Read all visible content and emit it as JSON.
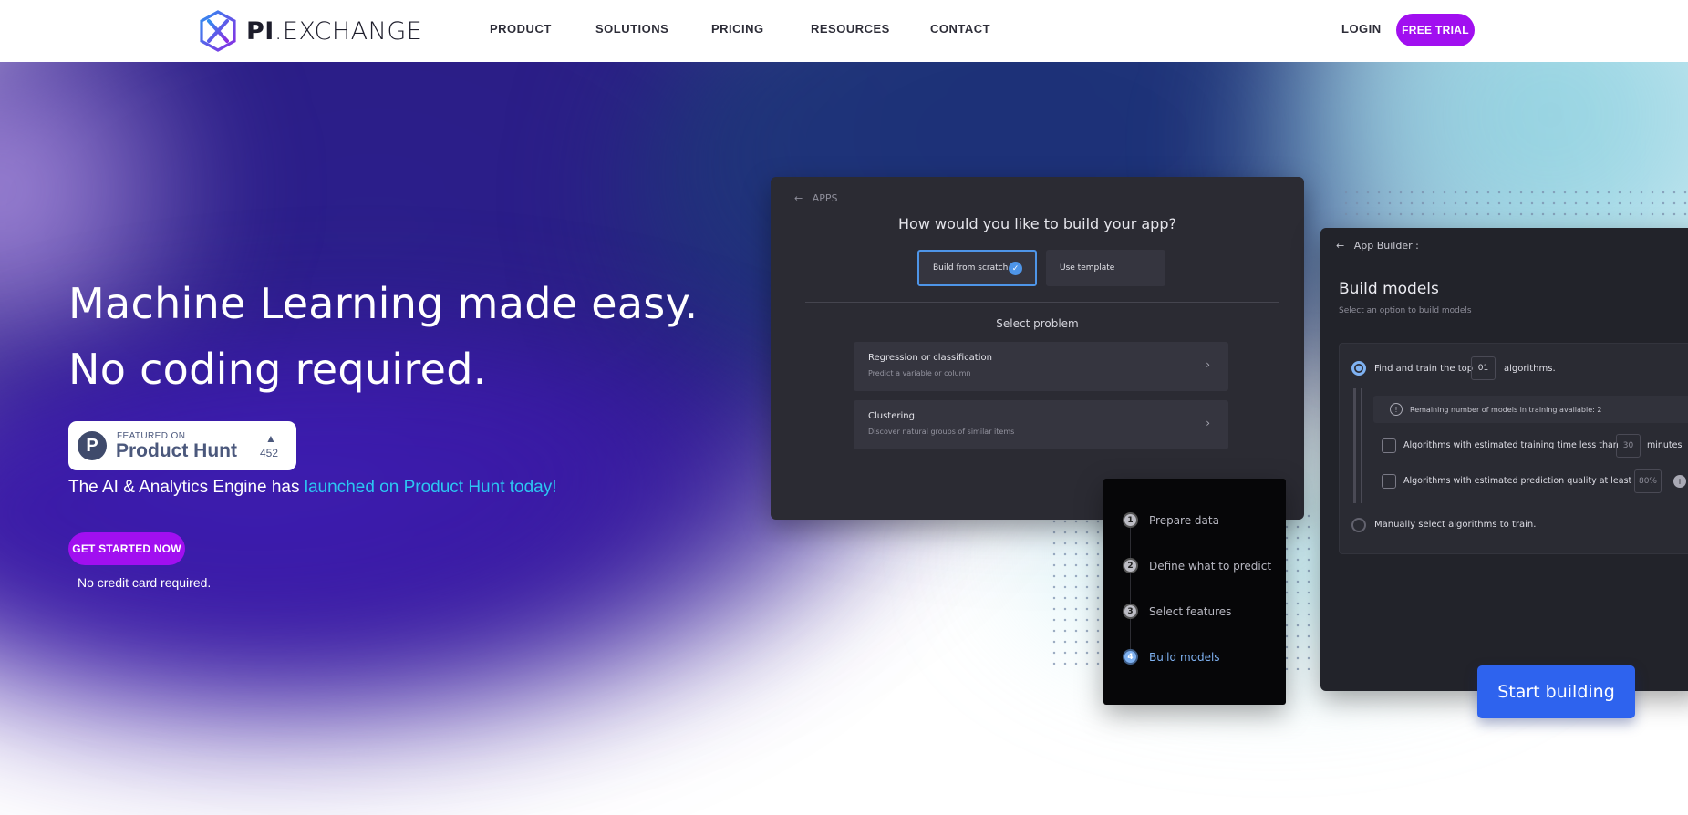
{
  "brand": {
    "logo_bold": "PI",
    "logo_light": ".EXCHANGE"
  },
  "nav": {
    "items": [
      "PRODUCT",
      "SOLUTIONS",
      "PRICING",
      "RESOURCES",
      "CONTACT"
    ],
    "login": "LOGIN",
    "trial": "FREE TRIAL"
  },
  "hero": {
    "headline_1": "Machine Learning made easy.",
    "headline_2": "No coding required.",
    "badge": {
      "logo_letter": "P",
      "small": "FEATURED ON",
      "big": "Product Hunt",
      "arrow": "▲",
      "count": "452"
    },
    "tagline_prefix": "The AI & Analytics Engine has ",
    "tagline_link": "launched on Product Hunt today!",
    "cta": "GET STARTED NOW",
    "note": "No credit card required."
  },
  "build_app": {
    "back": "APPS",
    "title": "How would you like to build your app?",
    "option_1": "Build from scratch",
    "option_2": "Use template",
    "check": "✓",
    "subtitle": "Select problem",
    "problems": [
      {
        "title": "Regression or classification",
        "desc": "Predict a variable or column",
        "chevron": "›"
      },
      {
        "title": "Clustering",
        "desc": "Discover natural groups of similar items",
        "chevron": "›"
      }
    ]
  },
  "app_builder": {
    "header": "App Builder :",
    "back": "←",
    "title": "Build models",
    "subtitle": "Select an option to build models",
    "find_prefix": "Find and train the top",
    "find_value": "01",
    "find_suffix": "algorithms.",
    "info_icon": "!",
    "remaining": "Remaining number of models in training available:  2",
    "time_label": "Algorithms with estimated training time less than",
    "time_value": "30",
    "time_unit": "minutes",
    "quality_label": "Algorithms with estimated prediction quality at least",
    "quality_value": "80%",
    "quality_info": "i",
    "manual": "Manually select algorithms to train."
  },
  "steps": [
    {
      "n": "1",
      "label": "Prepare data"
    },
    {
      "n": "2",
      "label": "Define what to predict"
    },
    {
      "n": "3",
      "label": "Select features"
    },
    {
      "n": "4",
      "label": "Build models"
    }
  ],
  "start_button": "Start building",
  "colors": {
    "accent_purple": "#a10ff0",
    "hero_indigo": "#2c1f8c",
    "link_cyan": "#2cc6f2",
    "primary_blue": "#2e63ee",
    "step_active": "#7fb2f2"
  }
}
